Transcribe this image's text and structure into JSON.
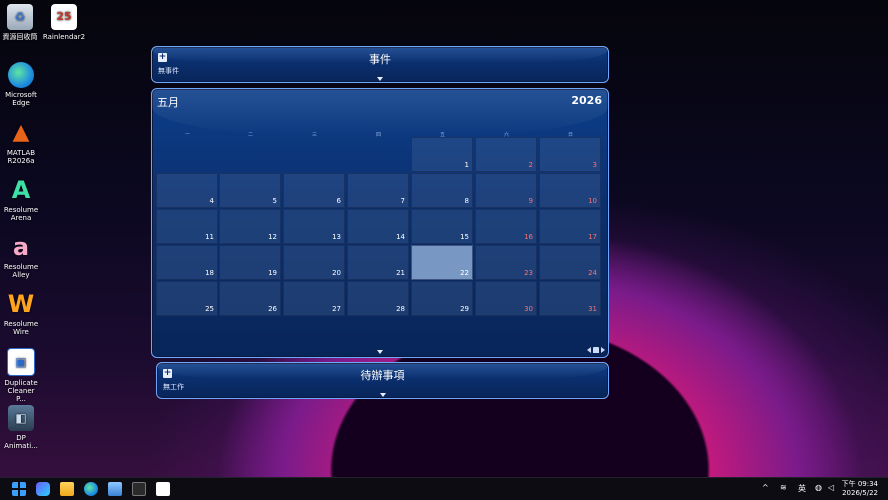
{
  "desktop": {
    "icons": [
      {
        "label": "資源回收筒"
      },
      {
        "label": "Rainlendar2"
      },
      {
        "label": "Microsoft Edge"
      },
      {
        "label": "MATLAB R2026a"
      },
      {
        "label": "Resolume Arena"
      },
      {
        "label": "Resolume Alley"
      },
      {
        "label": "Resolume Wire"
      },
      {
        "label": "Duplicate Cleaner P..."
      },
      {
        "label": "DP Animati..."
      }
    ],
    "rainlendar_badge": "25"
  },
  "events_panel": {
    "title": "事件",
    "subtitle": "無事件",
    "add": "+"
  },
  "calendar": {
    "month": "五月",
    "year": "2026",
    "weekdays": [
      "一",
      "二",
      "三",
      "四",
      "五",
      "六",
      "日"
    ],
    "days": [
      "1",
      "2",
      "3",
      "4",
      "5",
      "6",
      "7",
      "8",
      "9",
      "10",
      "11",
      "12",
      "13",
      "14",
      "15",
      "16",
      "17",
      "18",
      "19",
      "20",
      "21",
      "22",
      "23",
      "24",
      "25",
      "26",
      "27",
      "28",
      "29",
      "30",
      "31"
    ],
    "today": "22"
  },
  "todo_panel": {
    "title": "待辦事項",
    "subtitle": "無工作",
    "add": "+"
  },
  "taskbar": {
    "tray_lang": "英",
    "time": "下午 09:34",
    "date": "2026/5/22"
  }
}
